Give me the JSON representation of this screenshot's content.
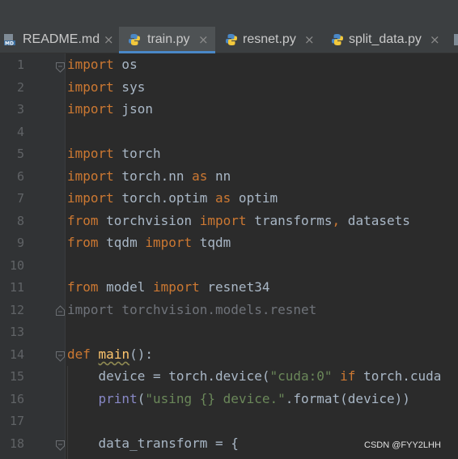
{
  "tabs": [
    {
      "label": "README.md",
      "icon": "markdown-file-icon",
      "icon_text": "MD",
      "active": false
    },
    {
      "label": "train.py",
      "icon": "python-file-icon",
      "active": true
    },
    {
      "label": "resnet.py",
      "icon": "python-file-icon",
      "active": false
    },
    {
      "label": "split_data.py",
      "icon": "python-file-icon",
      "active": false
    }
  ],
  "close_glyph": "×",
  "line_numbers": [
    "1",
    "2",
    "3",
    "4",
    "5",
    "6",
    "7",
    "8",
    "9",
    "10",
    "11",
    "12",
    "13",
    "14",
    "15",
    "16",
    "17",
    "18"
  ],
  "code": {
    "l1": {
      "kw": "import",
      "rest": " os"
    },
    "l2": {
      "kw": "import",
      "rest": " sys"
    },
    "l3": {
      "kw": "import",
      "rest": " json"
    },
    "l5": {
      "kw": "import",
      "rest": " torch"
    },
    "l6": {
      "kw": "import",
      "mid": " torch.nn ",
      "kw2": "as",
      "rest": " nn"
    },
    "l7": {
      "kw": "import",
      "mid": " torch.optim ",
      "kw2": "as",
      "rest": " optim"
    },
    "l8": {
      "kw": "from",
      "mid": " torchvision ",
      "kw2": "import",
      "mid2": " transforms",
      "comma": ",",
      "rest": " datasets"
    },
    "l9": {
      "kw": "from",
      "mid": " tqdm ",
      "kw2": "import",
      "rest": " tqdm"
    },
    "l11": {
      "kw": "from",
      "mid": " model ",
      "kw2": "import",
      "rest": " resnet34"
    },
    "l12": {
      "text": "import torchvision.models.resnet"
    },
    "l14": {
      "kw": "def",
      "space": " ",
      "fn": "main",
      "rest": "():"
    },
    "l15": {
      "lead": "    device = torch.device(",
      "str": "\"cuda:0\"",
      "space": " ",
      "kw": "if",
      "rest": " torch.cuda"
    },
    "l16": {
      "lead": "    ",
      "bi": "print",
      "open": "(",
      "str": "\"using {} device.\"",
      "rest": ".format(device))"
    },
    "l18": {
      "text": "    data_transform = {"
    }
  },
  "watermark": "CSDN @FYY2LHH",
  "colors": {
    "editor_bg": "#2b2b2b",
    "gutter_bg": "#313335",
    "keyword": "#cc7832",
    "string": "#6a8759",
    "builtin": "#8888c6",
    "function": "#ffc66d",
    "identifier": "#a9b7c6",
    "active_tab_underline": "#4a88c7"
  }
}
